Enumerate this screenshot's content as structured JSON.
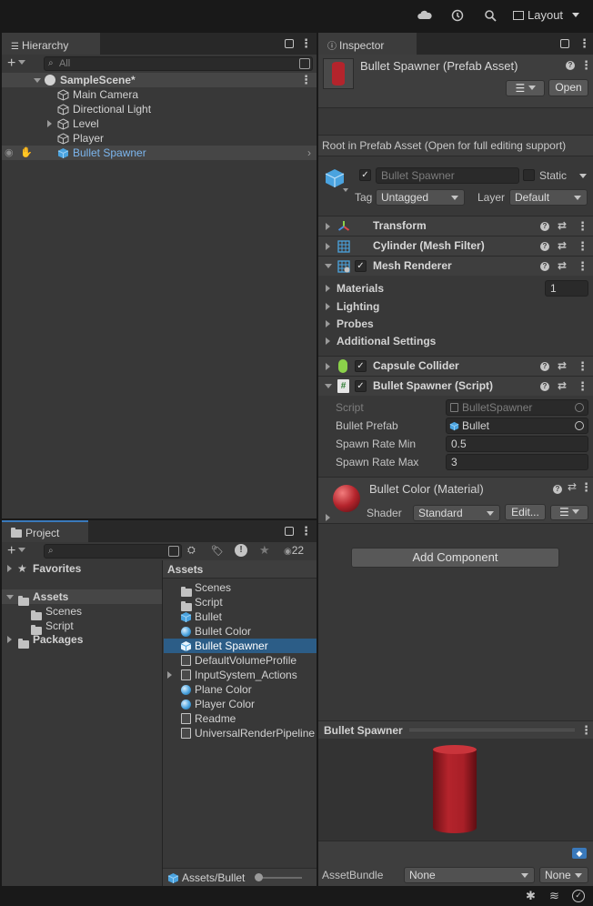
{
  "toolbar": {
    "layout_label": "Layout"
  },
  "hierarchy": {
    "tab_label": "Hierarchy",
    "search_placeholder": "All",
    "scene_name": "SampleScene*",
    "items": [
      "Main Camera",
      "Directional Light",
      "Level",
      "Player",
      "Bullet Spawner"
    ]
  },
  "project": {
    "tab_label": "Project",
    "hidden_count": "22",
    "favorites": "Favorites",
    "assets": "Assets",
    "assets_children": [
      "Scenes",
      "Script"
    ],
    "packages": "Packages",
    "assets_header": "Assets",
    "files": [
      "Scenes",
      "Script",
      "Bullet",
      "Bullet Color",
      "Bullet Spawner",
      "DefaultVolumeProfile",
      "InputSystem_Actions",
      "Plane Color",
      "Player Color",
      "Readme",
      "UniversalRenderPipeline"
    ],
    "footer_path": "Assets/Bullet"
  },
  "inspector": {
    "tab_label": "Inspector",
    "asset_title": "Bullet Spawner (Prefab Asset)",
    "open_label": "Open",
    "root_note": "Root in Prefab Asset (Open for full editing support)",
    "object_name": "Bullet Spawner",
    "static_label": "Static",
    "tag_label": "Tag",
    "tag_value": "Untagged",
    "layer_label": "Layer",
    "layer_value": "Default",
    "components": {
      "transform": "Transform",
      "mesh_filter": "Cylinder (Mesh Filter)",
      "mesh_renderer": "Mesh Renderer",
      "capsule_collider": "Capsule Collider",
      "bullet_spawner": "Bullet Spawner (Script)"
    },
    "mesh_renderer": {
      "materials_label": "Materials",
      "materials_count": "1",
      "lighting": "Lighting",
      "probes": "Probes",
      "additional": "Additional Settings"
    },
    "script_fields": {
      "script_label": "Script",
      "script_value": "BulletSpawner",
      "prefab_label": "Bullet Prefab",
      "prefab_value": "Bullet",
      "min_label": "Spawn Rate Min",
      "min_value": "0.5",
      "max_label": "Spawn Rate Max",
      "max_value": "3"
    },
    "material": {
      "title": "Bullet Color (Material)",
      "shader_label": "Shader",
      "shader_value": "Standard",
      "edit_label": "Edit..."
    },
    "add_component": "Add Component",
    "preview_title": "Bullet Spawner",
    "assetbundle_label": "AssetBundle",
    "assetbundle_value": "None",
    "assetbundle_variant": "None"
  },
  "colors": {
    "selection": "#2c5d87",
    "accent": "#3a79bb",
    "cube_blue": "#4aa3df",
    "bullet_red": "#b4242c"
  }
}
